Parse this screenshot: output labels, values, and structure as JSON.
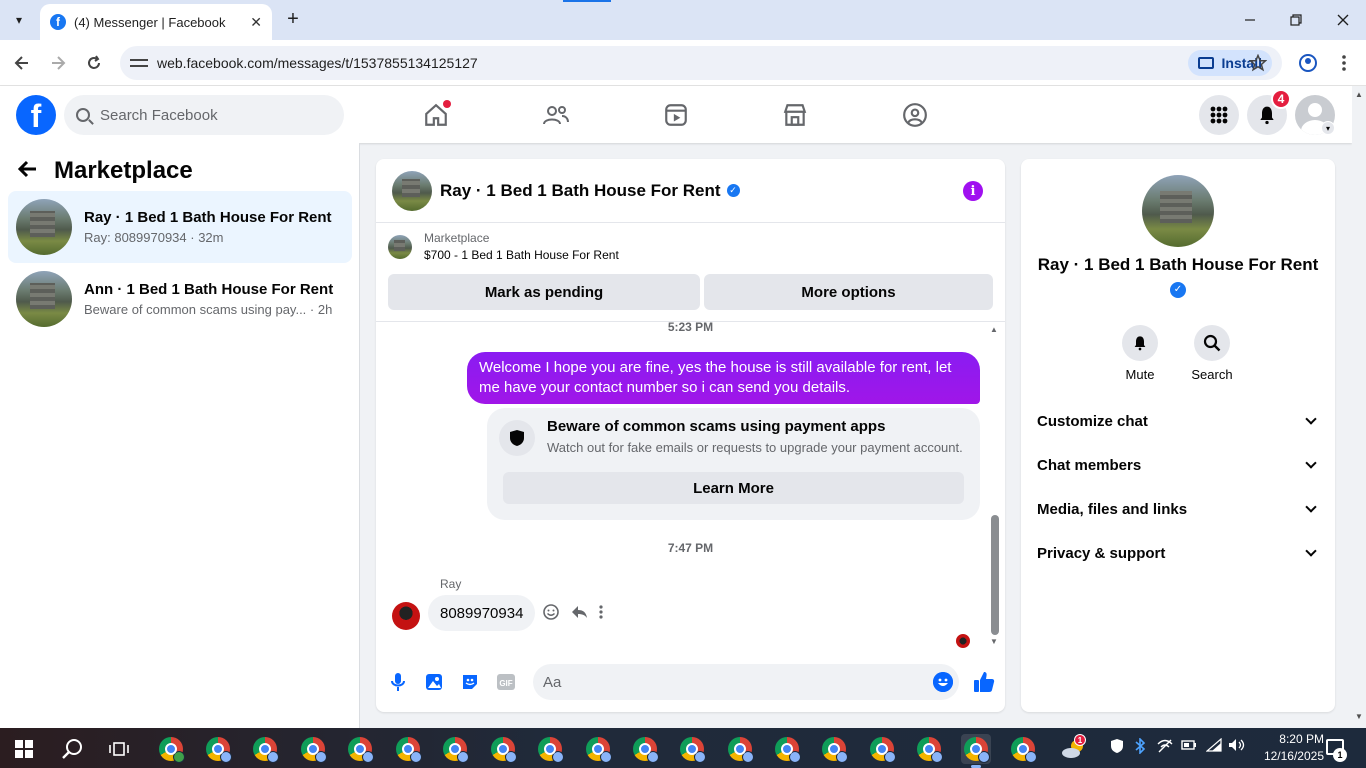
{
  "browser": {
    "tab_title": "(4) Messenger | Facebook",
    "url": "web.facebook.com/messages/t/1537855134125127",
    "install_label": "Install",
    "new_tab": "+",
    "tab_close": "✕"
  },
  "fb": {
    "search_placeholder": "Search Facebook",
    "notifications_badge": "4",
    "colors": {
      "brand": "#0866ff",
      "accent_purple": "#a010f0",
      "badge_red": "#e41e3f"
    }
  },
  "left": {
    "heading": "Marketplace",
    "conversations": [
      {
        "title": "Ray · 1 Bed 1 Bath House For Rent",
        "preview": "Ray: 8089970934 · 32m"
      },
      {
        "title": "Ann · 1 Bed 1 Bath House For Rent",
        "preview": "Beware of common scams using pay...  · 2h"
      }
    ]
  },
  "chat": {
    "title": "Ray · 1 Bed 1 Bath House For Rent",
    "marketplace_label": "Marketplace",
    "listing": "$700 - 1 Bed 1 Bath House For Rent",
    "mark_pending": "Mark as pending",
    "more_options": "More options",
    "time1": "5:23 PM",
    "outgoing_message": "Welcome I hope you are fine, yes the house is still available for rent, let me have your contact number so i can send you  details.",
    "scam_title": "Beware of common scams using payment apps",
    "scam_sub": "Watch out for fake emails or requests to upgrade your payment account.",
    "learn_more": "Learn More",
    "time2": "7:47 PM",
    "sender": "Ray",
    "incoming_message": "8089970934",
    "composer_placeholder": "Aa"
  },
  "info": {
    "name": "Ray · 1 Bed 1 Bath House For Rent",
    "mute": "Mute",
    "search": "Search",
    "sections": [
      "Customize chat",
      "Chat members",
      "Media, files and links",
      "Privacy & support"
    ]
  },
  "taskbar": {
    "time": "8:20 PM",
    "date": "12/16/2025",
    "notif_count": "1",
    "weather_badge": "1"
  }
}
